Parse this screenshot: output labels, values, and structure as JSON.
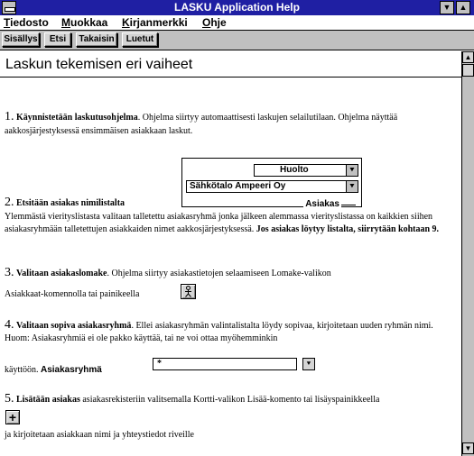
{
  "window": {
    "title": "LASKU Application Help"
  },
  "menu": [
    {
      "pre": "",
      "u": "T",
      "post": "iedosto"
    },
    {
      "pre": "",
      "u": "M",
      "post": "uokkaa"
    },
    {
      "pre": "",
      "u": "K",
      "post": "irjanmerkki"
    },
    {
      "pre": "",
      "u": "O",
      "post": "hje"
    }
  ],
  "toolbar": {
    "contents": "Sisällys",
    "search": "Etsi",
    "back": "Takaisin",
    "history": "Luetut"
  },
  "content": {
    "heading": "Laskun tekemisen eri vaiheet",
    "step1": {
      "num": "1.",
      "bold": "Käynnistetään laskutusohjelma",
      "text": ". Ohjelma siirtyy automaattisesti laskujen selailutilaan. Ohjelma näyttää aakkosjärjestyksessä ensimmäisen asiakkaan laskut."
    },
    "widget": {
      "group_value": "Huolto",
      "customer_value": "Sähkötalo Ampeeri Oy",
      "label": "Asiakas"
    },
    "step2": {
      "num": "2.",
      "bold": "Etsitään asiakas nimilistalta",
      "text": "Ylemmästä vierityslistasta valitaan talletettu asiakasryhmä jonka jälkeen alemmassa vierityslistassa on kaikkien siihen asiakasryhmään talletettujen asiakkaiden nimet aakkosjärjestyksessä.",
      "bold2": "Jos asiakas löytyy listalta, siirrytään kohtaan 9."
    },
    "step3": {
      "num": "3.",
      "bold": "Valitaan asiakaslomake",
      "text": ". Ohjelma siirtyy asiakastietojen selaamiseen Lomake-valikon",
      "text2": "Asiakkaat-komennolla tai painikeella"
    },
    "step4": {
      "num": "4.",
      "bold": "Valitaan sopiva asiakasryhmä",
      "text": ". Ellei asiakasryhmän valintalistalta löydy sopivaa, kirjoitetaan uuden ryhmän nimi. Huom: Asiakasryhmiä ei ole pakko käyttää, tai ne voi ottaa myöhemminkin",
      "text2": "käyttöön.",
      "field_label": "Asiakasryhmä",
      "field_value": "*"
    },
    "step5": {
      "num": "5.",
      "bold": "Lisätään asiakas",
      "text": " asiakasrekisteriin valitsemalla Kortti-valikon Lisää-komento tai lisäyspainikkeella",
      "text2": "ja kirjoitetaan asiakkaan nimi ja yhteystiedot riveille"
    }
  },
  "colors": {
    "titlebar": "#1f1fa3",
    "toolbar": "#c0c0c0"
  },
  "icons": {
    "form_button": "person-form-icon",
    "add_button": "plus-icon"
  }
}
